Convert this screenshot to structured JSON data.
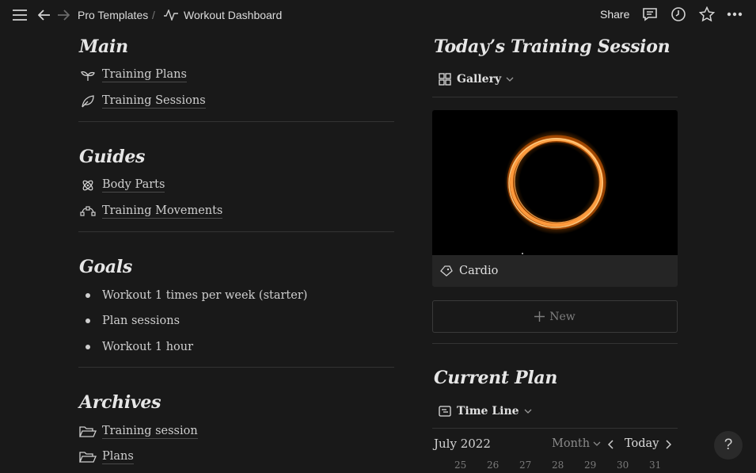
{
  "topbar": {
    "breadcrumb_parent": "Pro Templates",
    "breadcrumb_sep": "/",
    "breadcrumb_current": "Workout Dashboard",
    "share_label": "Share"
  },
  "main": {
    "title": "Main",
    "items": [
      {
        "label": "Training Plans",
        "icon": "sprout-icon"
      },
      {
        "label": "Training Sessions",
        "icon": "leaf-icon"
      }
    ]
  },
  "guides": {
    "title": "Guides",
    "items": [
      {
        "label": "Body Parts",
        "icon": "atom-icon"
      },
      {
        "label": "Training Movements",
        "icon": "bezier-curve-icon"
      }
    ]
  },
  "goals": {
    "title": "Goals",
    "items": [
      "Workout 1 times per week (starter)",
      "Plan sessions",
      "Workout 1 hour"
    ]
  },
  "archives": {
    "title": "Archives",
    "items": [
      {
        "label": "Training session",
        "icon": "folder-open-icon"
      },
      {
        "label": "Plans",
        "icon": "folder-open-icon"
      }
    ]
  },
  "todays_session": {
    "title": "Today’s Training Session",
    "view_label": "Gallery",
    "card_title": "Cardio",
    "new_label": "New"
  },
  "current_plan": {
    "title": "Current Plan",
    "view_label": "Time Line",
    "month": "July 2022",
    "scale": "Month",
    "today_label": "Today",
    "days": [
      "25",
      "26",
      "27",
      "28",
      "29",
      "30",
      "31"
    ]
  },
  "help_label": "?",
  "colors": {
    "background": "#191919",
    "text": "#d4d4d4",
    "ring_orange": "#ff9a3c"
  }
}
